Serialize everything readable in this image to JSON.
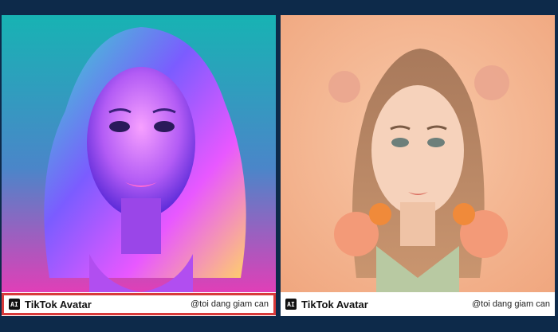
{
  "cards": [
    {
      "logo_text": "AI",
      "brand": "TikTok Avatar",
      "handle": "@toi dang giam can",
      "style": "neon holographic portrait",
      "colors": {
        "bg_top": "#19b8b8",
        "bg_bottom": "#e03fb7",
        "accent": "#7a3cff"
      }
    },
    {
      "logo_text": "AI",
      "brand": "TikTok Avatar",
      "handle": "@toi dang giam can",
      "style": "pastel floral portrait",
      "colors": {
        "bg": "#f2b08c",
        "accent": "#f08a3a"
      }
    }
  ],
  "highlight_color": "#d83a3a",
  "page_background": "#0d2a4a"
}
